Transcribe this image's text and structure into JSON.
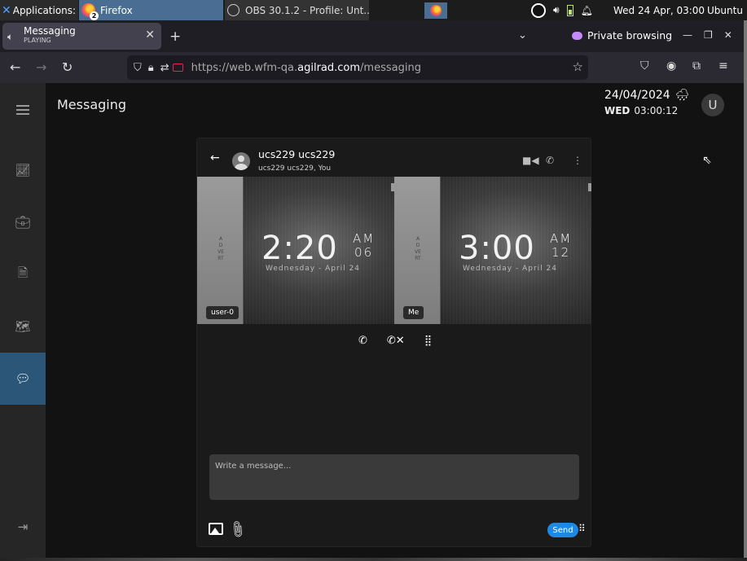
{
  "taskbar": {
    "applications": "Applications",
    "separator": ":",
    "firefox_label": "Firefox",
    "firefox_badge": "2",
    "obs_label": "OBS 30.1.2 - Profile: Unt...",
    "clock": "Wed 24 Apr, 03:00",
    "user": "Ubuntu"
  },
  "browser": {
    "tab_title": "Messaging",
    "tab_status": "PLAYING",
    "private_label": "Private browsing",
    "url_prefix": "https://web.wfm-qa.",
    "url_domain": "agilrad.com",
    "url_path": "/messaging"
  },
  "app": {
    "page_title": "Messaging",
    "date": "24/04/2024",
    "weekday": "WED",
    "time": "03:00:12",
    "avatar_initial": "U",
    "weather_icon": "rain-cloud-icon",
    "sidebar_active": "messaging",
    "accent_color": "#2c5677"
  },
  "chat": {
    "name": "ucs229 ucs229",
    "participants": "ucs229 ucs229, You",
    "videos": [
      {
        "label": "user-0",
        "advert": "ADVERT",
        "hm": "2:20",
        "am": "AM",
        "sec": "06",
        "date": "Wednesday - April 24"
      },
      {
        "label": "Me",
        "advert": "ADVERT",
        "hm": "3:00",
        "am": "AM",
        "sec": "12",
        "date": "Wednesday - April 24"
      }
    ],
    "input_placeholder": "Write a message...",
    "send_label": "Send",
    "send_color": "#1e88e5"
  }
}
